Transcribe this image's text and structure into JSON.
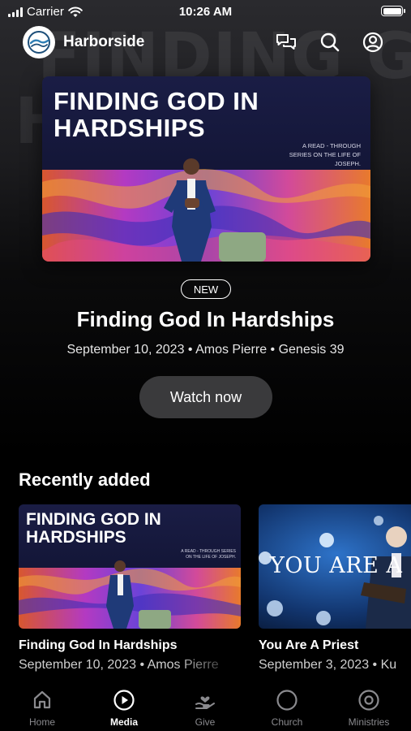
{
  "status_bar": {
    "carrier": "Carrier",
    "time": "10:26 AM"
  },
  "header": {
    "app_name": "Harborside",
    "icons": [
      "chat-icon",
      "search-icon",
      "profile-icon"
    ]
  },
  "hero": {
    "art_title": "FINDING GOD IN HARDSHIPS",
    "art_series": "A READ - THROUGH SERIES ON THE LIFE OF JOSEPH.",
    "badge": "NEW",
    "title": "Finding God In Hardships",
    "meta": "September 10, 2023 • Amos Pierre • Genesis 39",
    "button": "Watch now"
  },
  "recently_added": {
    "heading": "Recently added",
    "items": [
      {
        "art_title": "FINDING GOD IN HARDSHIPS",
        "art_series": "A READ - THROUGH SERIES ON THE LIFE OF JOSEPH.",
        "title": "Finding God In Hardships",
        "meta": "September 10, 2023 • Amos Pierre"
      },
      {
        "art_title": "YOU ARE A PRIEST",
        "title": "You Are A Priest",
        "meta": "September 3, 2023 • Ku"
      }
    ]
  },
  "tabs": [
    {
      "label": "Home",
      "icon": "home-icon",
      "active": false
    },
    {
      "label": "Media",
      "icon": "play-circle-icon",
      "active": true
    },
    {
      "label": "Give",
      "icon": "give-heart-icon",
      "active": false
    },
    {
      "label": "Church",
      "icon": "circle-icon",
      "active": false
    },
    {
      "label": "Ministries",
      "icon": "target-circle-icon",
      "active": false
    }
  ],
  "colors": {
    "background": "#000000",
    "button": "#3a3a3c",
    "inactive_tab": "#8a8a8e",
    "accent": "#ffffff"
  }
}
